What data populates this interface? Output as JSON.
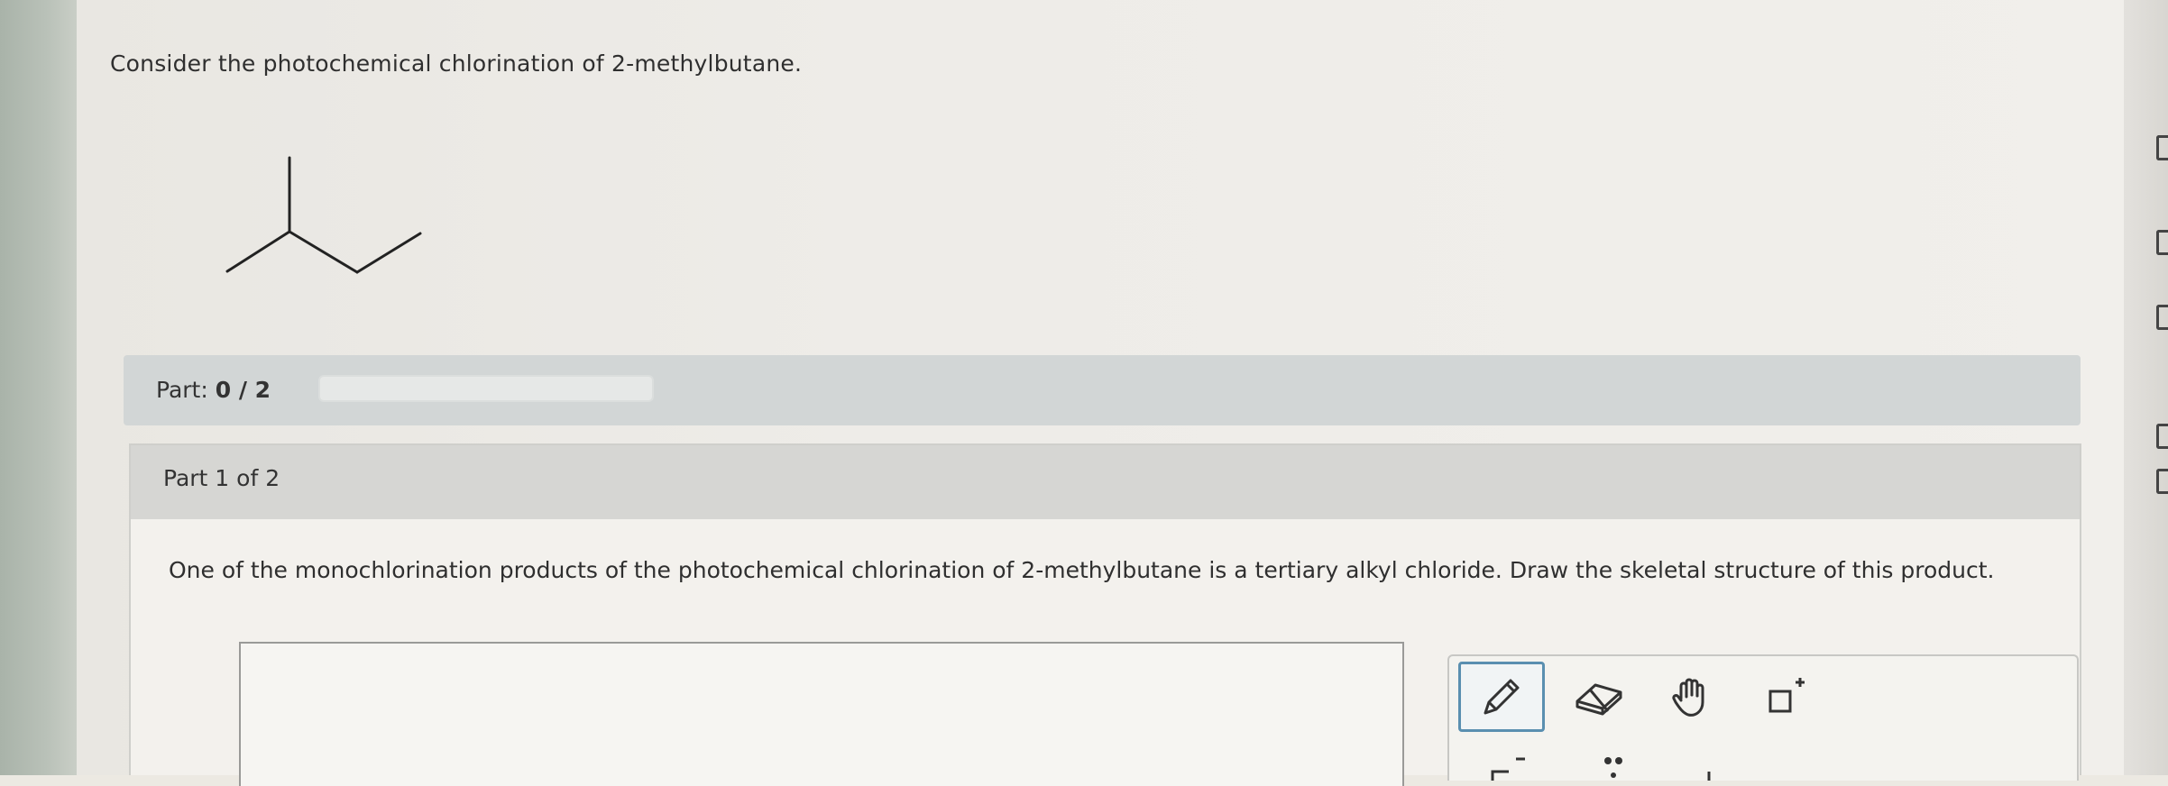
{
  "question": {
    "title": "Consider the photochemical chlorination of 2-methylbutane."
  },
  "part_bar": {
    "label": "Part:",
    "value": "0 / 2",
    "progress": 0
  },
  "part_card": {
    "heading": "Part 1 of 2",
    "prompt": "One of the monochlorination products of the photochemical chlorination of 2-methylbutane is a tertiary alkyl chloride. Draw the skeletal structure of this product."
  },
  "toolbar": {
    "tools": [
      {
        "icon": "pencil-icon",
        "selected": true
      },
      {
        "icon": "eraser-icon",
        "selected": false
      },
      {
        "icon": "hand-icon",
        "selected": false
      },
      {
        "icon": "add-box-icon",
        "selected": false
      }
    ]
  },
  "colors": {
    "accent_border": "#5a8fb0",
    "part_bar_bg": "#d2d6d6",
    "header_bg": "#d6d6d3"
  }
}
